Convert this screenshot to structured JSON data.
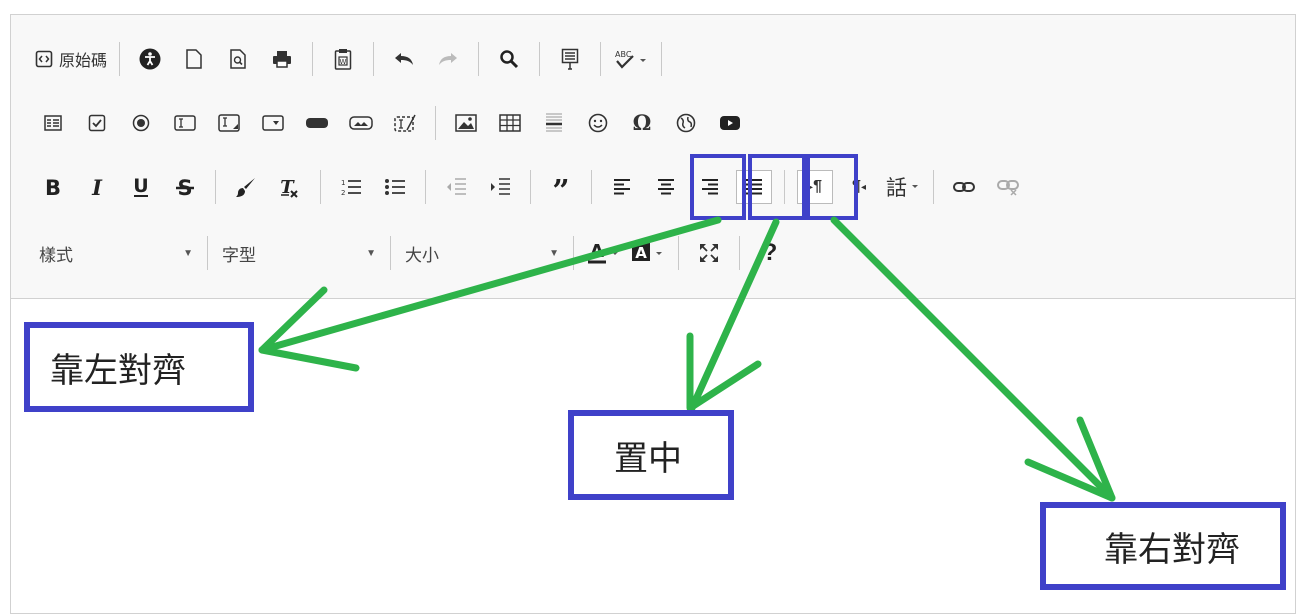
{
  "toolbar": {
    "source_label": "原始碼",
    "justify_text_glyph": "話",
    "pilcrow": "¶",
    "styles_label": "樣式",
    "font_label": "字型",
    "size_label": "大小",
    "help_glyph": "?"
  },
  "annotations": {
    "left_align_label": "靠左對齊",
    "center_label": "置中",
    "right_align_label": "靠右對齊",
    "highlight_color": "#3f41c9",
    "arrow_color": "#2eb34a"
  }
}
